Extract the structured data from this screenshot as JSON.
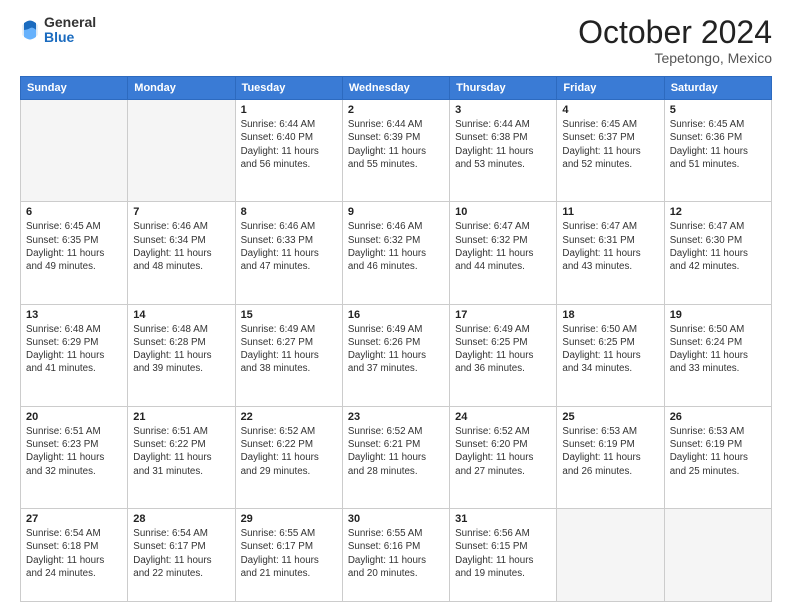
{
  "header": {
    "logo_general": "General",
    "logo_blue": "Blue",
    "month": "October 2024",
    "location": "Tepetongo, Mexico"
  },
  "days_of_week": [
    "Sunday",
    "Monday",
    "Tuesday",
    "Wednesday",
    "Thursday",
    "Friday",
    "Saturday"
  ],
  "weeks": [
    [
      {
        "num": "",
        "info": ""
      },
      {
        "num": "",
        "info": ""
      },
      {
        "num": "1",
        "info": "Sunrise: 6:44 AM\nSunset: 6:40 PM\nDaylight: 11 hours and 56 minutes."
      },
      {
        "num": "2",
        "info": "Sunrise: 6:44 AM\nSunset: 6:39 PM\nDaylight: 11 hours and 55 minutes."
      },
      {
        "num": "3",
        "info": "Sunrise: 6:44 AM\nSunset: 6:38 PM\nDaylight: 11 hours and 53 minutes."
      },
      {
        "num": "4",
        "info": "Sunrise: 6:45 AM\nSunset: 6:37 PM\nDaylight: 11 hours and 52 minutes."
      },
      {
        "num": "5",
        "info": "Sunrise: 6:45 AM\nSunset: 6:36 PM\nDaylight: 11 hours and 51 minutes."
      }
    ],
    [
      {
        "num": "6",
        "info": "Sunrise: 6:45 AM\nSunset: 6:35 PM\nDaylight: 11 hours and 49 minutes."
      },
      {
        "num": "7",
        "info": "Sunrise: 6:46 AM\nSunset: 6:34 PM\nDaylight: 11 hours and 48 minutes."
      },
      {
        "num": "8",
        "info": "Sunrise: 6:46 AM\nSunset: 6:33 PM\nDaylight: 11 hours and 47 minutes."
      },
      {
        "num": "9",
        "info": "Sunrise: 6:46 AM\nSunset: 6:32 PM\nDaylight: 11 hours and 46 minutes."
      },
      {
        "num": "10",
        "info": "Sunrise: 6:47 AM\nSunset: 6:32 PM\nDaylight: 11 hours and 44 minutes."
      },
      {
        "num": "11",
        "info": "Sunrise: 6:47 AM\nSunset: 6:31 PM\nDaylight: 11 hours and 43 minutes."
      },
      {
        "num": "12",
        "info": "Sunrise: 6:47 AM\nSunset: 6:30 PM\nDaylight: 11 hours and 42 minutes."
      }
    ],
    [
      {
        "num": "13",
        "info": "Sunrise: 6:48 AM\nSunset: 6:29 PM\nDaylight: 11 hours and 41 minutes."
      },
      {
        "num": "14",
        "info": "Sunrise: 6:48 AM\nSunset: 6:28 PM\nDaylight: 11 hours and 39 minutes."
      },
      {
        "num": "15",
        "info": "Sunrise: 6:49 AM\nSunset: 6:27 PM\nDaylight: 11 hours and 38 minutes."
      },
      {
        "num": "16",
        "info": "Sunrise: 6:49 AM\nSunset: 6:26 PM\nDaylight: 11 hours and 37 minutes."
      },
      {
        "num": "17",
        "info": "Sunrise: 6:49 AM\nSunset: 6:25 PM\nDaylight: 11 hours and 36 minutes."
      },
      {
        "num": "18",
        "info": "Sunrise: 6:50 AM\nSunset: 6:25 PM\nDaylight: 11 hours and 34 minutes."
      },
      {
        "num": "19",
        "info": "Sunrise: 6:50 AM\nSunset: 6:24 PM\nDaylight: 11 hours and 33 minutes."
      }
    ],
    [
      {
        "num": "20",
        "info": "Sunrise: 6:51 AM\nSunset: 6:23 PM\nDaylight: 11 hours and 32 minutes."
      },
      {
        "num": "21",
        "info": "Sunrise: 6:51 AM\nSunset: 6:22 PM\nDaylight: 11 hours and 31 minutes."
      },
      {
        "num": "22",
        "info": "Sunrise: 6:52 AM\nSunset: 6:22 PM\nDaylight: 11 hours and 29 minutes."
      },
      {
        "num": "23",
        "info": "Sunrise: 6:52 AM\nSunset: 6:21 PM\nDaylight: 11 hours and 28 minutes."
      },
      {
        "num": "24",
        "info": "Sunrise: 6:52 AM\nSunset: 6:20 PM\nDaylight: 11 hours and 27 minutes."
      },
      {
        "num": "25",
        "info": "Sunrise: 6:53 AM\nSunset: 6:19 PM\nDaylight: 11 hours and 26 minutes."
      },
      {
        "num": "26",
        "info": "Sunrise: 6:53 AM\nSunset: 6:19 PM\nDaylight: 11 hours and 25 minutes."
      }
    ],
    [
      {
        "num": "27",
        "info": "Sunrise: 6:54 AM\nSunset: 6:18 PM\nDaylight: 11 hours and 24 minutes."
      },
      {
        "num": "28",
        "info": "Sunrise: 6:54 AM\nSunset: 6:17 PM\nDaylight: 11 hours and 22 minutes."
      },
      {
        "num": "29",
        "info": "Sunrise: 6:55 AM\nSunset: 6:17 PM\nDaylight: 11 hours and 21 minutes."
      },
      {
        "num": "30",
        "info": "Sunrise: 6:55 AM\nSunset: 6:16 PM\nDaylight: 11 hours and 20 minutes."
      },
      {
        "num": "31",
        "info": "Sunrise: 6:56 AM\nSunset: 6:15 PM\nDaylight: 11 hours and 19 minutes."
      },
      {
        "num": "",
        "info": ""
      },
      {
        "num": "",
        "info": ""
      }
    ]
  ]
}
